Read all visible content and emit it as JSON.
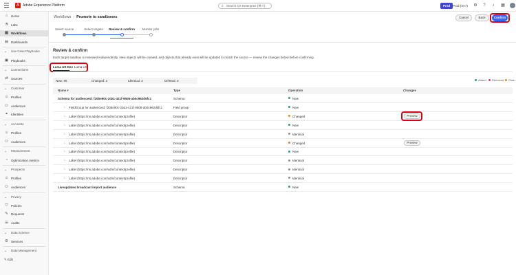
{
  "topbar": {
    "app_title": "Adobe Experience Platform",
    "search_placeholder": "Search CX Enterprise (⌘+/)",
    "env_badge": "Prod",
    "env_name": "Prod (VA7)"
  },
  "sidebar": {
    "items": [
      {
        "label": "Home",
        "icon": "home-icon",
        "glyph": "⌂",
        "kind": "item"
      },
      {
        "label": "Labs",
        "icon": "labs-icon",
        "glyph": "⚗",
        "kind": "item"
      },
      {
        "label": "Workflows",
        "icon": "workflows-icon",
        "glyph": "▦",
        "kind": "item",
        "active": true
      },
      {
        "label": "Dashboards",
        "icon": "dashboards-icon",
        "glyph": "▤",
        "kind": "item"
      },
      {
        "label": "Use Case Playbooks",
        "kind": "section"
      },
      {
        "label": "Playbooks",
        "icon": "playbooks-icon",
        "glyph": "▣",
        "kind": "item"
      },
      {
        "label": "Connections",
        "kind": "section"
      },
      {
        "label": "Sources",
        "icon": "sources-icon",
        "glyph": "⇄",
        "kind": "item"
      },
      {
        "label": "Customer",
        "kind": "section"
      },
      {
        "label": "Profiles",
        "icon": "profiles-icon",
        "glyph": "☺",
        "kind": "item"
      },
      {
        "label": "Audiences",
        "icon": "audiences-icon",
        "glyph": "⚇",
        "kind": "item"
      },
      {
        "label": "Identities",
        "icon": "identities-icon",
        "glyph": "⚭",
        "kind": "item"
      },
      {
        "label": "Accounts",
        "kind": "section"
      },
      {
        "label": "Profiles",
        "icon": "account-profiles-icon",
        "glyph": "☺",
        "kind": "item"
      },
      {
        "label": "Audiences",
        "icon": "account-audiences-icon",
        "glyph": "⚇",
        "kind": "item"
      },
      {
        "label": "Measurement",
        "kind": "section"
      },
      {
        "label": "Optimization metrics",
        "icon": "metrics-icon",
        "glyph": "◔",
        "kind": "item"
      },
      {
        "label": "Prospects",
        "kind": "section"
      },
      {
        "label": "Profiles",
        "icon": "prospect-profiles-icon",
        "glyph": "☺",
        "kind": "item"
      },
      {
        "label": "Audiences",
        "icon": "prospect-audiences-icon",
        "glyph": "⚇",
        "kind": "item"
      },
      {
        "label": "Privacy",
        "kind": "section"
      },
      {
        "label": "Policies",
        "icon": "policies-icon",
        "glyph": "⛉",
        "kind": "item"
      },
      {
        "label": "Requests",
        "icon": "requests-icon",
        "glyph": "✎",
        "kind": "item"
      },
      {
        "label": "Audits",
        "icon": "audits-icon",
        "glyph": "☰",
        "kind": "item"
      },
      {
        "label": "Data Science",
        "kind": "section"
      },
      {
        "label": "Services",
        "icon": "services-icon",
        "glyph": "⚙",
        "kind": "item"
      },
      {
        "label": "Data Management",
        "kind": "section"
      }
    ],
    "bottom_label": "Edit"
  },
  "breadcrumb": {
    "parent": "Workflows",
    "current": "Promote to sandboxes"
  },
  "actions": {
    "cancel": "Cancel",
    "back": "Back",
    "confirm": "Confirm"
  },
  "stepper": [
    "Select source",
    "Select targets",
    "Review & confirm",
    "Monitor jobs"
  ],
  "review": {
    "title": "Review & confirm",
    "description": "Each target sandbox is reviewed independently. New objects will be created, and objects that already exist will be updated to match the source — review the changes below before confirming."
  },
  "sandbox_tabs": [
    "Luma US Dev",
    "Luma US"
  ],
  "summary": {
    "new": "New: 95",
    "changed": "Changed: 3",
    "identical": "Identical: 3",
    "deleted": "Deleted: 0"
  },
  "legend": {
    "added": "Added",
    "removed": "Removed",
    "changed": "Chan"
  },
  "colors": {
    "accent": "#3b63fb",
    "new": "#2d9d78",
    "changed": "#e68619",
    "identical": "#8e8e8e",
    "highlight": "#d7000f"
  },
  "table": {
    "headers": {
      "name": "Name",
      "type": "Type",
      "operation": "Operation",
      "changes": "Changes"
    },
    "rows": [
      {
        "name": "Schema for audienceId: f20be90c-2da1-421f-9508-ab0c962d5fc1",
        "type": "Schema",
        "op": "New",
        "status": "new",
        "child": false,
        "bold": true
      },
      {
        "name": "FieldGroup for audienceId: f20be90c-2da1-421f-9508-ab0c962d5fc1",
        "type": "Field group",
        "op": "New",
        "status": "new",
        "child": true
      },
      {
        "name": "Label (https://ns.adobe.com/xdm/context/profile)",
        "type": "Descriptor",
        "op": "Changed",
        "status": "changed",
        "child": true,
        "preview": "Preview",
        "highlight": true
      },
      {
        "name": "Label (https://ns.adobe.com/xdm/context/profile)",
        "type": "Descriptor",
        "op": "New",
        "status": "new",
        "child": true
      },
      {
        "name": "Label (https://ns.adobe.com/xdm/context/profile)",
        "type": "Descriptor",
        "op": "Identical",
        "status": "identical",
        "child": true
      },
      {
        "name": "Label (https://ns.adobe.com/xdm/context/profile)",
        "type": "Descriptor",
        "op": "Changed",
        "status": "changed",
        "child": true,
        "preview": "Preview"
      },
      {
        "name": "Label (https://ns.adobe.com/xdm/context/profile)",
        "type": "Descriptor",
        "op": "New",
        "status": "new",
        "child": true
      },
      {
        "name": "Label (https://ns.adobe.com/xdm/context/profile)",
        "type": "Descriptor",
        "op": "Identical",
        "status": "identical",
        "child": true
      },
      {
        "name": "Label (https://ns.adobe.com/xdm/context/profile)",
        "type": "Descriptor",
        "op": "Identical",
        "status": "identical",
        "child": true
      },
      {
        "name": "Label (https://ns.adobe.com/xdm/context/profile)",
        "type": "Descriptor",
        "op": "Identical",
        "status": "identical",
        "child": true
      },
      {
        "name": "Liveupdates broadcast import audience",
        "type": "Schema",
        "op": "New",
        "status": "new",
        "child": false,
        "bold": true
      }
    ]
  }
}
